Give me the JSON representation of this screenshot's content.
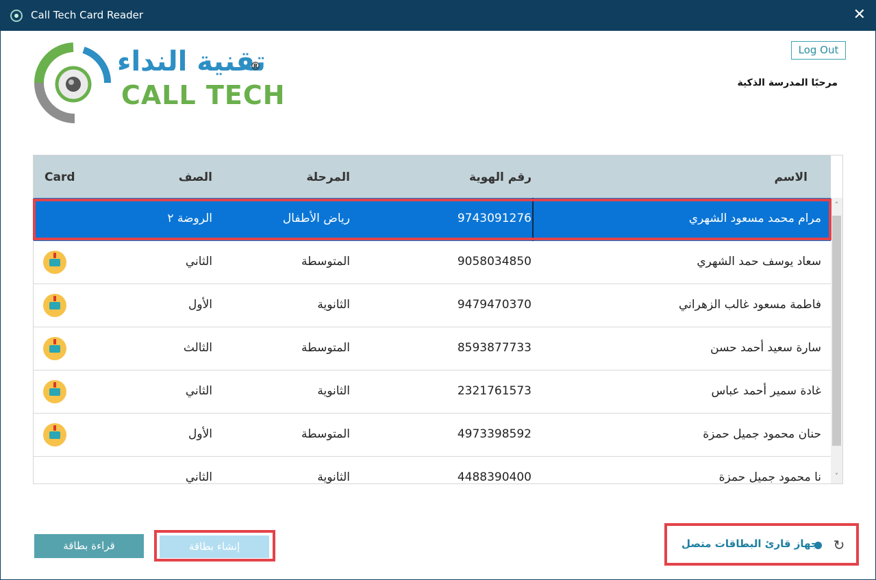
{
  "window": {
    "title": "Call Tech Card Reader",
    "close_label": "✕"
  },
  "logo": {
    "arabic": "تقنية النداء",
    "registered": "®",
    "english": "CALL TECH"
  },
  "header": {
    "logout_label": "Log Out",
    "welcome": "مرحبًا المدرسة الذكية"
  },
  "table": {
    "columns": {
      "card": "Card",
      "class": "الصف",
      "stage": "المرحلة",
      "id": "رقم الهوية",
      "name": "الاسم"
    },
    "rows": [
      {
        "name": "مرام محمد مسعود الشهري",
        "id": "9743091276",
        "stage": "رياض الأطفال",
        "class": "الروضة ٢",
        "has_card": false,
        "selected": true
      },
      {
        "name": "سعاد يوسف حمد الشهري",
        "id": "9058034850",
        "stage": "المتوسطة",
        "class": "الثاني",
        "has_card": true,
        "selected": false
      },
      {
        "name": "فاطمة مسعود غالب الزهراني",
        "id": "9479470370",
        "stage": "الثانوية",
        "class": "الأول",
        "has_card": true,
        "selected": false
      },
      {
        "name": "سارة سعيد أحمد حسن",
        "id": "8593877733",
        "stage": "المتوسطة",
        "class": "الثالث",
        "has_card": true,
        "selected": false
      },
      {
        "name": "غادة سمير أحمد عباس",
        "id": "2321761573",
        "stage": "الثانوية",
        "class": "الثاني",
        "has_card": true,
        "selected": false
      },
      {
        "name": "حنان محمود جميل حمزة",
        "id": "4973398592",
        "stage": "المتوسطة",
        "class": "الأول",
        "has_card": true,
        "selected": false
      },
      {
        "name": "نا محمود جميل حمزة",
        "id": "4488390400",
        "stage": "الثانوية",
        "class": "الثاني",
        "has_card": false,
        "selected": false
      }
    ]
  },
  "buttons": {
    "read_card": "قراءة بطاقة",
    "create_card": "إنشاء بطاقة"
  },
  "status": {
    "text": "جهاز قارئ البطاقات متصل",
    "refresh_icon": "↻"
  },
  "colors": {
    "titlebar": "#0f3e5e",
    "selection": "#0a75d6",
    "highlight": "#e3434a",
    "status": "#1e7fa0"
  }
}
